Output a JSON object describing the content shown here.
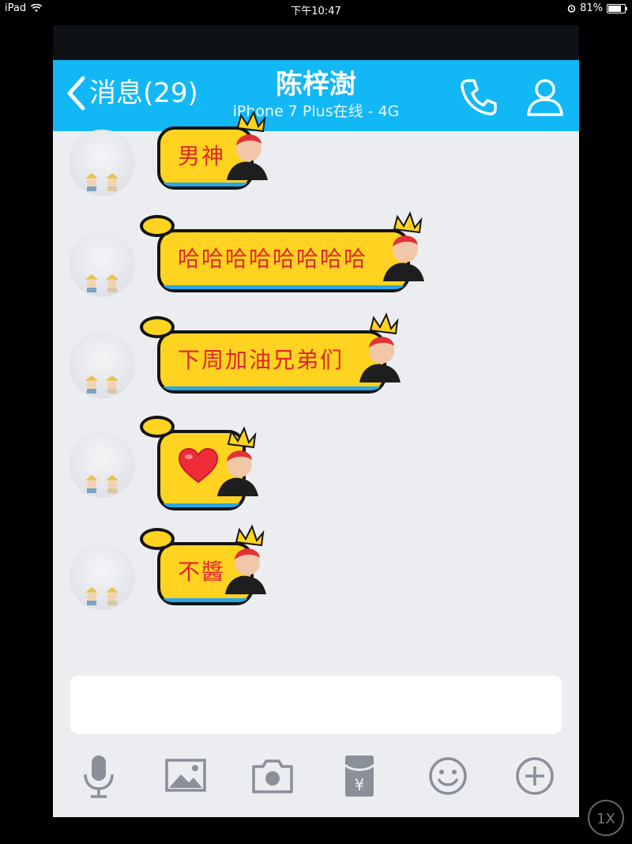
{
  "ipad_status": {
    "device": "iPad",
    "time": "下午10:47",
    "battery": "81%",
    "battery_level": 0.81
  },
  "nav": {
    "back_label": "消息(29)",
    "title": "陈梓澍",
    "subtitle": "iPhone 7 Plus在线 - 4G"
  },
  "messages": [
    {
      "text": "男神"
    },
    {
      "text": "哈哈哈哈哈哈哈哈"
    },
    {
      "text": "下周加油兄弟们"
    },
    {
      "type": "emoji",
      "icon": "heart-icon"
    },
    {
      "text": "不醬"
    }
  ],
  "input": {
    "placeholder": "",
    "value": ""
  },
  "toolbar": [
    "microphone-icon",
    "image-icon",
    "camera-icon",
    "red-packet-icon",
    "emoji-icon",
    "plus-icon"
  ],
  "zoom_label": "1X",
  "colors": {
    "nav": "#12b7f5",
    "bubble": "#ffd320",
    "bubble_text": "#e0262a",
    "chat_bg": "#ebedf0"
  }
}
